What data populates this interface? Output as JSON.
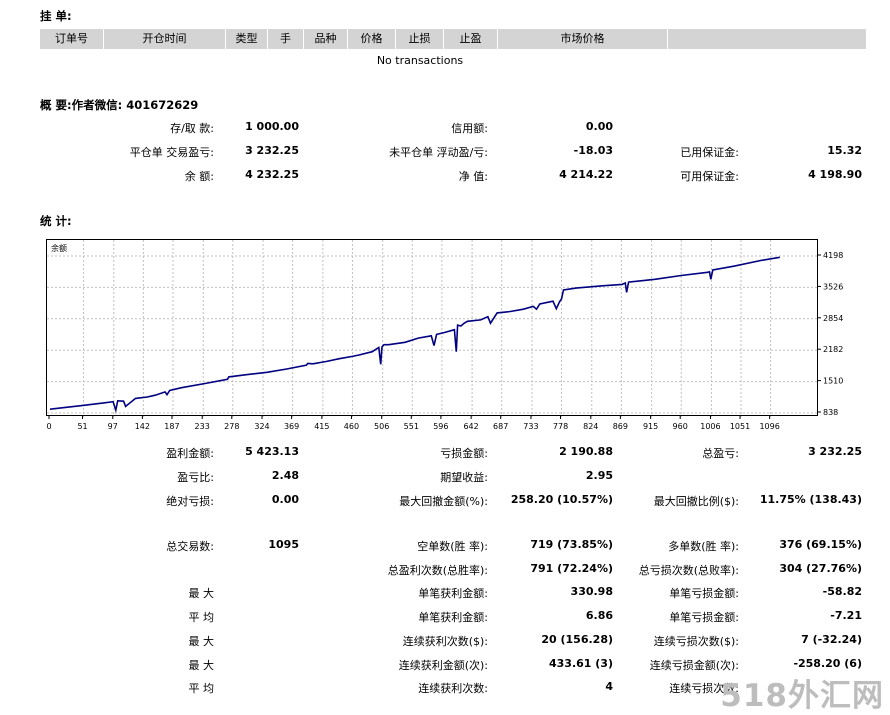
{
  "orders": {
    "title": "挂 单:",
    "columns": [
      "订单号",
      "开仓时间",
      "类型",
      "手",
      "品种",
      "价格",
      "止损",
      "止盈",
      "市场价格",
      ""
    ],
    "empty_text": "No transactions"
  },
  "summary": {
    "title": "概 要:作者微信: 401672629",
    "rows": [
      [
        {
          "label": "存/取 款:",
          "value": "1 000.00"
        },
        {
          "label": "信用额:",
          "value": "0.00"
        },
        {
          "label": "",
          "value": ""
        }
      ],
      [
        {
          "label": "平仓单 交易盈亏:",
          "value": "3 232.25"
        },
        {
          "label": "未平仓单 浮动盈/亏:",
          "value": "-18.03"
        },
        {
          "label": "已用保证金:",
          "value": "15.32"
        }
      ],
      [
        {
          "label": "余 额:",
          "value": "4 232.25"
        },
        {
          "label": "净 值:",
          "value": "4 214.22"
        },
        {
          "label": "可用保证金:",
          "value": "4 198.90"
        }
      ]
    ]
  },
  "stats": {
    "title": "统 计:",
    "rows": [
      [
        {
          "label": "盈利金额:",
          "value": "5 423.13"
        },
        {
          "label": "亏损金额:",
          "value": "2 190.88"
        },
        {
          "label": "总盈亏:",
          "value": "3 232.25"
        }
      ],
      [
        {
          "label": "盈亏比:",
          "value": "2.48"
        },
        {
          "label": "期望收益:",
          "value": "2.95"
        },
        {
          "label": "",
          "value": ""
        }
      ],
      [
        {
          "label": "绝对亏损:",
          "value": "0.00"
        },
        {
          "label": "最大回撤金额(%):",
          "value": "258.20 (10.57%)"
        },
        {
          "label": "最大回撤比例($):",
          "value": "11.75% (138.43)"
        }
      ],
      [
        {
          "label": "总交易数:",
          "value": "1095"
        },
        {
          "label": "空单数(胜 率):",
          "value": "719 (73.85%)"
        },
        {
          "label": "多单数(胜 率):",
          "value": "376 (69.15%)"
        }
      ],
      [
        {
          "label": "",
          "value": ""
        },
        {
          "label": "总盈利次数(总胜率):",
          "value": "791 (72.24%)"
        },
        {
          "label": "总亏损次数(总败率):",
          "value": "304 (27.76%)"
        }
      ],
      [
        {
          "label": "最 大",
          "value": ""
        },
        {
          "label": "单笔获利金额:",
          "value": "330.98"
        },
        {
          "label": "单笔亏损金额:",
          "value": "-58.82"
        }
      ],
      [
        {
          "label": "平 均",
          "value": ""
        },
        {
          "label": "单笔获利金额:",
          "value": "6.86"
        },
        {
          "label": "单笔亏损金额:",
          "value": "-7.21"
        }
      ],
      [
        {
          "label": "最 大",
          "value": ""
        },
        {
          "label": "连续获利次数($):",
          "value": "20 (156.28)"
        },
        {
          "label": "连续亏损次数($):",
          "value": "7 (-32.24)"
        }
      ],
      [
        {
          "label": "最 大",
          "value": ""
        },
        {
          "label": "连续获利金额(次):",
          "value": "433.61 (3)"
        },
        {
          "label": "连续亏损金额(次):",
          "value": "-258.20 (6)"
        }
      ],
      [
        {
          "label": "平 均",
          "value": ""
        },
        {
          "label": "连续获利次数:",
          "value": "4"
        },
        {
          "label": "连续亏损次数:",
          "value": ""
        }
      ]
    ]
  },
  "watermark": "518外汇网",
  "chart_data": {
    "type": "line",
    "title": "余额",
    "xlabel": "",
    "ylabel": "",
    "x_ticks": [
      0,
      51,
      97,
      142,
      187,
      233,
      278,
      324,
      369,
      415,
      460,
      506,
      551,
      596,
      642,
      687,
      733,
      778,
      824,
      869,
      915,
      960,
      1006,
      1051,
      1096
    ],
    "y_ticks": [
      838,
      1510,
      2182,
      2854,
      3526,
      4198
    ],
    "xlim": [
      0,
      1130
    ],
    "ylim": [
      838,
      4290
    ],
    "grid": true,
    "line_color": "#000080",
    "series": [
      {
        "x": [
          0,
          50,
          80,
          96,
          100,
          103,
          112,
          115,
          130,
          148,
          160,
          175,
          178,
          182,
          200,
          240,
          270,
          272,
          300,
          330,
          360,
          390,
          392,
          400,
          420,
          440,
          460,
          470,
          490,
          500,
          503,
          505,
          508,
          515,
          540,
          560,
          580,
          584,
          588,
          600,
          615,
          618,
          620,
          625,
          630,
          635,
          655,
          666,
          670,
          680,
          700,
          720,
          735,
          740,
          745,
          765,
          770,
          775,
          778,
          781,
          800,
          840,
          870,
          875,
          877,
          880,
          920,
          960,
          1000,
          1003,
          1005,
          1008,
          1040,
          1080,
          1110
        ],
        "y": [
          920,
          1000,
          1050,
          1080,
          900,
          1100,
          1090,
          980,
          1150,
          1180,
          1220,
          1290,
          1230,
          1320,
          1380,
          1480,
          1560,
          1610,
          1660,
          1710,
          1780,
          1860,
          1900,
          1890,
          1940,
          2000,
          2050,
          2080,
          2150,
          2240,
          1880,
          2250,
          2300,
          2300,
          2350,
          2440,
          2490,
          2280,
          2520,
          2560,
          2620,
          2150,
          2720,
          2700,
          2760,
          2800,
          2830,
          2900,
          2760,
          2980,
          3010,
          3060,
          3120,
          3060,
          3170,
          3230,
          3070,
          3220,
          3280,
          3470,
          3510,
          3560,
          3590,
          3620,
          3420,
          3640,
          3700,
          3780,
          3850,
          3860,
          3700,
          3900,
          3980,
          4100,
          4170
        ]
      }
    ]
  }
}
